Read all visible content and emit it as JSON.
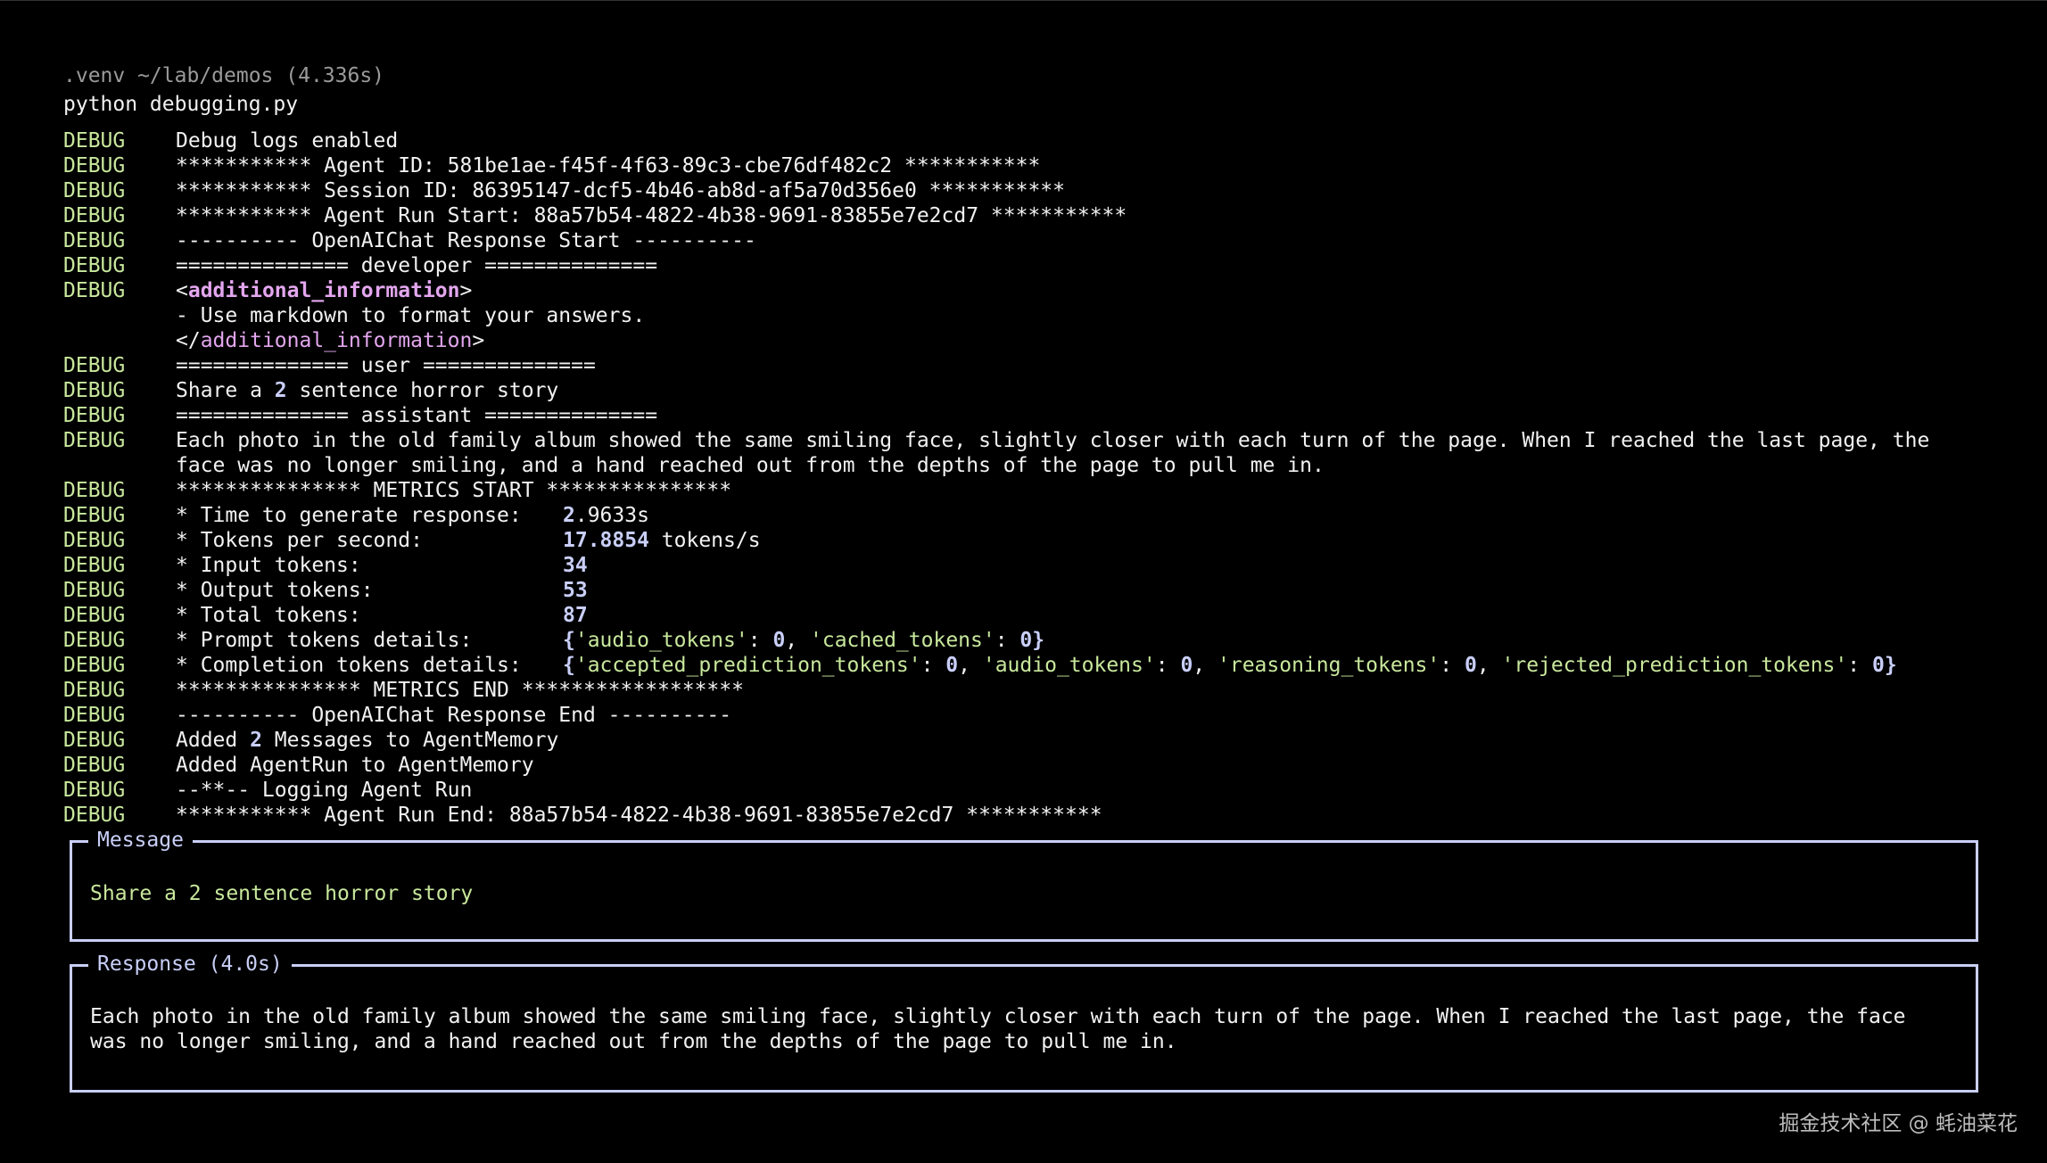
{
  "window": {
    "prompt_path": ".venv ~/lab/demos (4.336s)",
    "command": "python debugging.py"
  },
  "log": {
    "level": "DEBUG",
    "enabled": "Debug logs enabled",
    "agent_id": "*********** Agent ID: 581be1ae-f45f-4f63-89c3-cbe76df482c2 ***********",
    "session_id": "*********** Session ID: 86395147-dcf5-4b46-ab8d-af5a70d356e0 ***********",
    "run_start": "*********** Agent Run Start: 88a57b54-4822-4b38-9691-83855e7e2cd7 ***********",
    "response_start": "---------- OpenAIChat Response Start ----------",
    "developer_header": "============== developer ==============",
    "tag_open_lt": "<",
    "tag_name": "additional_information",
    "tag_gt": ">",
    "instruction": "- Use markdown to format your answers.",
    "tag_close_lt": "</",
    "user_header": "============== user ==============",
    "user_msg_pre": "Share a ",
    "user_msg_num": "2",
    "user_msg_post": " sentence horror story",
    "assistant_header": "============== assistant ==============",
    "assistant_line1": "Each photo in the old family album showed the same smiling face, slightly closer with each turn of the page. When I reached the last page, the",
    "assistant_line2": "face was no longer smiling, and a hand reached out from the depths of the page to pull me in.",
    "metrics_start": "*************** METRICS START ***************",
    "m_time_label": "* Time to generate response:",
    "m_time_num": "2",
    "m_time_rest": ".9633s",
    "m_tps_label": "* Tokens per second:",
    "m_tps_num": "17.8854",
    "m_tps_unit": " tokens/s",
    "m_input_label": "* Input tokens:",
    "m_input": "34",
    "m_output_label": "* Output tokens:",
    "m_output": "53",
    "m_total_label": "* Total tokens:",
    "m_total": "87",
    "m_prompt_label": "* Prompt tokens details:",
    "k_audio": "'audio_tokens'",
    "k_cached": "'cached_tokens'",
    "m_completion_label": "* Completion tokens details:",
    "k_accepted": "'accepted_prediction_tokens'",
    "k_reasoning": "'reasoning_tokens'",
    "k_rejected": "'rejected_prediction_tokens'",
    "zero": "0",
    "brace_open": "{",
    "brace_close": "}",
    "colon": ": ",
    "comma": ", ",
    "metrics_end": "*************** METRICS END ******************",
    "response_end": "---------- OpenAIChat Response End ----------",
    "added_pre": "Added ",
    "added_num": "2",
    "added_post": " Messages to AgentMemory",
    "added_run": "Added AgentRun to AgentMemory",
    "logging_run": "--**-- Logging Agent Run",
    "run_end": "*********** Agent Run End: 88a57b54-4822-4b38-9691-83855e7e2cd7 ***********"
  },
  "message_panel": {
    "title": "Message",
    "body": "Share a 2 sentence horror story"
  },
  "response_panel": {
    "title": "Response (4.0s)",
    "body": "Each photo in the old family album showed the same smiling face, slightly closer with each turn of the page. When I reached the last page, the face\nwas no longer smiling, and a hand reached out from the depths of the page to pull me in."
  },
  "watermark": "掘金技术社区 @ 蚝油菜花",
  "colors": {
    "background": "#000000",
    "debug_level": "#c8e89c",
    "tag": "#e3a6ee",
    "number": "#c9cff8",
    "panel_border": "#c9cff8"
  }
}
